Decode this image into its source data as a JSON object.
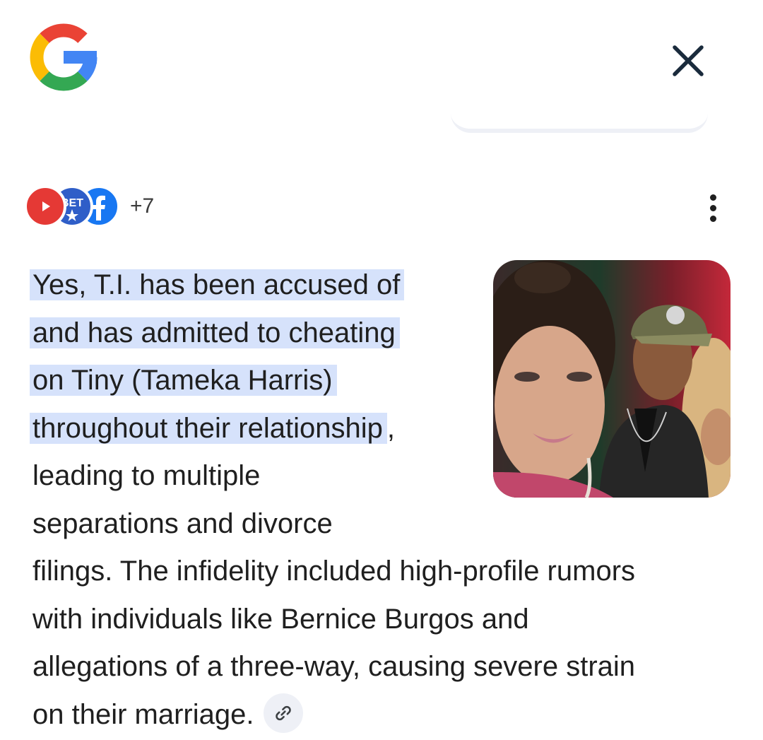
{
  "header": {
    "logo_icon": "google-g-icon",
    "close_icon": "close-icon"
  },
  "sources": {
    "icons": [
      "youtube-icon",
      "bet-icon",
      "facebook-icon"
    ],
    "more_count": "+7",
    "menu_icon": "more-vertical-icon"
  },
  "answer": {
    "highlighted_lines": [
      "Yes, T.I. has been accused of",
      "and has admitted to cheating",
      "on Tiny (Tameka Harris)",
      "throughout their relationship"
    ],
    "highlight_trailing": ",",
    "lines_beside_image": [
      "leading to multiple",
      "separations and divorce"
    ],
    "lines_full": [
      "filings. The infidelity included high-profile rumors",
      "with individuals like Bernice Burgos and",
      "allegations of a three-way, causing severe strain",
      "on their marriage."
    ],
    "link_icon": "link-icon"
  },
  "image": {
    "subject": "photo-of-couple"
  },
  "colors": {
    "highlight": "#d6e2fb",
    "text": "#1f1f1f",
    "chip_bg": "#eef0f6"
  }
}
